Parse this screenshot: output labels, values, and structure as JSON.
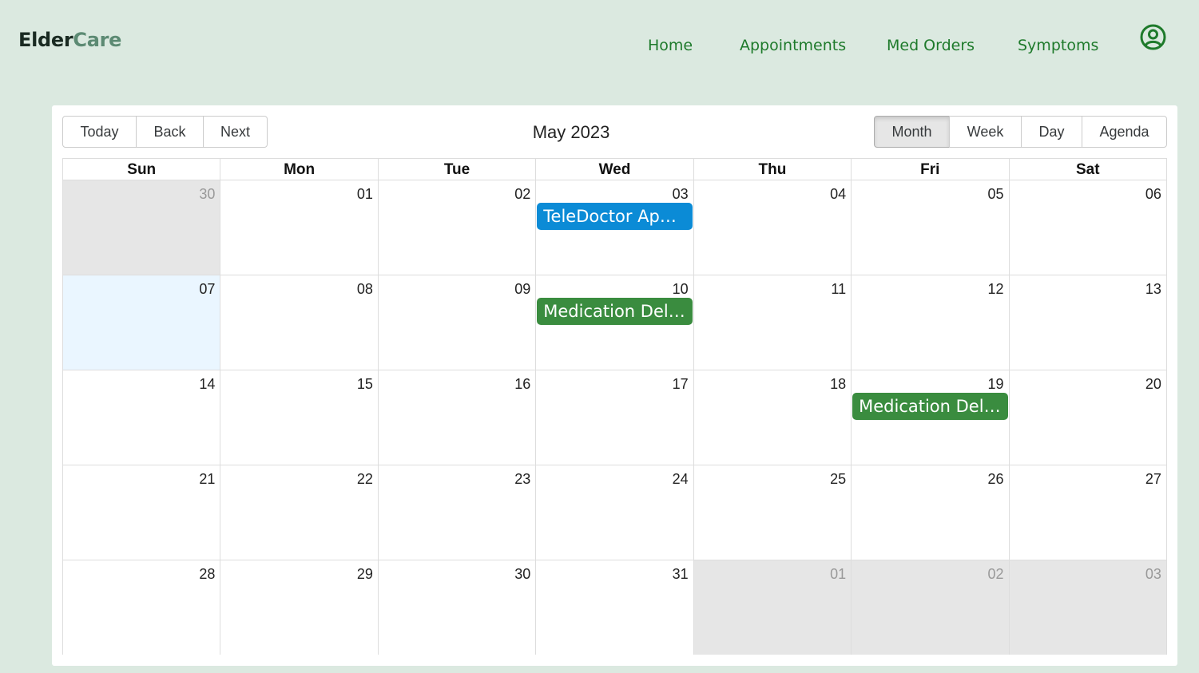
{
  "brand": {
    "part1": "Elder",
    "part2": "Care"
  },
  "nav": {
    "home": "Home",
    "appointments": "Appointments",
    "med_orders": "Med Orders",
    "symptoms": "Symptoms"
  },
  "calendar": {
    "nav_buttons": {
      "today": "Today",
      "back": "Back",
      "next": "Next"
    },
    "label": "May 2023",
    "views": {
      "month": "Month",
      "week": "Week",
      "day": "Day",
      "agenda": "Agenda",
      "active": "Month"
    },
    "weekdays": [
      "Sun",
      "Mon",
      "Tue",
      "Wed",
      "Thu",
      "Fri",
      "Sat"
    ],
    "weeks": [
      [
        "30",
        "01",
        "02",
        "03",
        "04",
        "05",
        "06"
      ],
      [
        "07",
        "08",
        "09",
        "10",
        "11",
        "12",
        "13"
      ],
      [
        "14",
        "15",
        "16",
        "17",
        "18",
        "19",
        "20"
      ],
      [
        "21",
        "22",
        "23",
        "24",
        "25",
        "26",
        "27"
      ],
      [
        "28",
        "29",
        "30",
        "31",
        "01",
        "02",
        "03"
      ]
    ],
    "off_range": [
      [
        0,
        0
      ],
      [
        4,
        4
      ],
      [
        4,
        5
      ],
      [
        4,
        6
      ]
    ],
    "today": [
      1,
      0
    ],
    "events": [
      {
        "title": "TeleDoctor Appointment",
        "week": 0,
        "day": 3,
        "color": "#0b8bd6"
      },
      {
        "title": "Medication Delivery",
        "week": 1,
        "day": 3,
        "color": "#3a8c3f"
      },
      {
        "title": "Medication Delivery",
        "week": 2,
        "day": 5,
        "color": "#3a8c3f"
      }
    ]
  },
  "colors": {
    "background": "#dbe9e0",
    "nav_link": "#1e7a2b",
    "today_bg": "#eaf6ff",
    "off_bg": "#e6e6e6"
  }
}
